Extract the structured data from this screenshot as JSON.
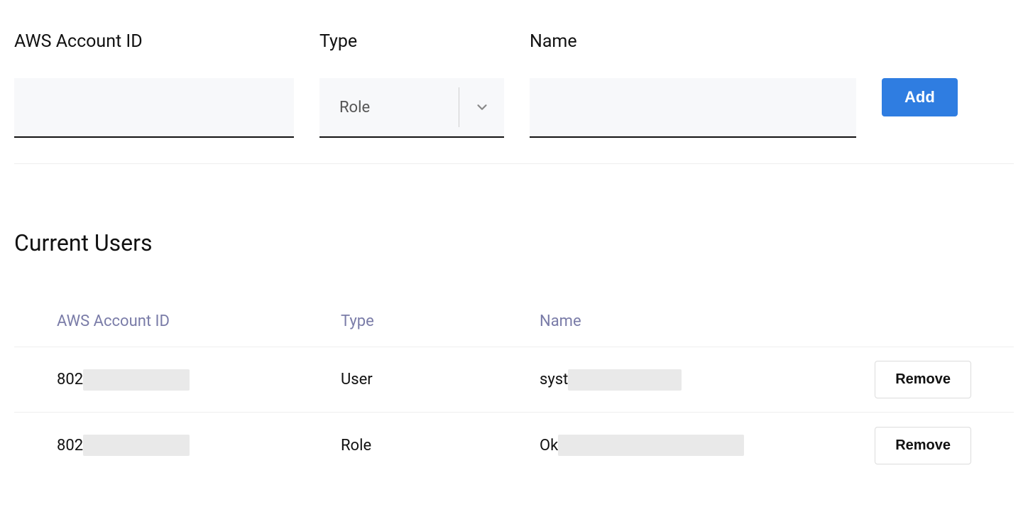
{
  "form": {
    "account_label": "AWS Account ID",
    "account_value": "",
    "type_label": "Type",
    "type_selected": "Role",
    "name_label": "Name",
    "name_value": "",
    "add_button": "Add"
  },
  "section_heading": "Current Users",
  "columns": {
    "account": "AWS Account ID",
    "type": "Type",
    "name": "Name"
  },
  "rows": [
    {
      "account_prefix": "802",
      "type": "User",
      "name_prefix": "syst",
      "action": "Remove"
    },
    {
      "account_prefix": "802",
      "type": "Role",
      "name_prefix": "Ok",
      "action": "Remove"
    }
  ]
}
